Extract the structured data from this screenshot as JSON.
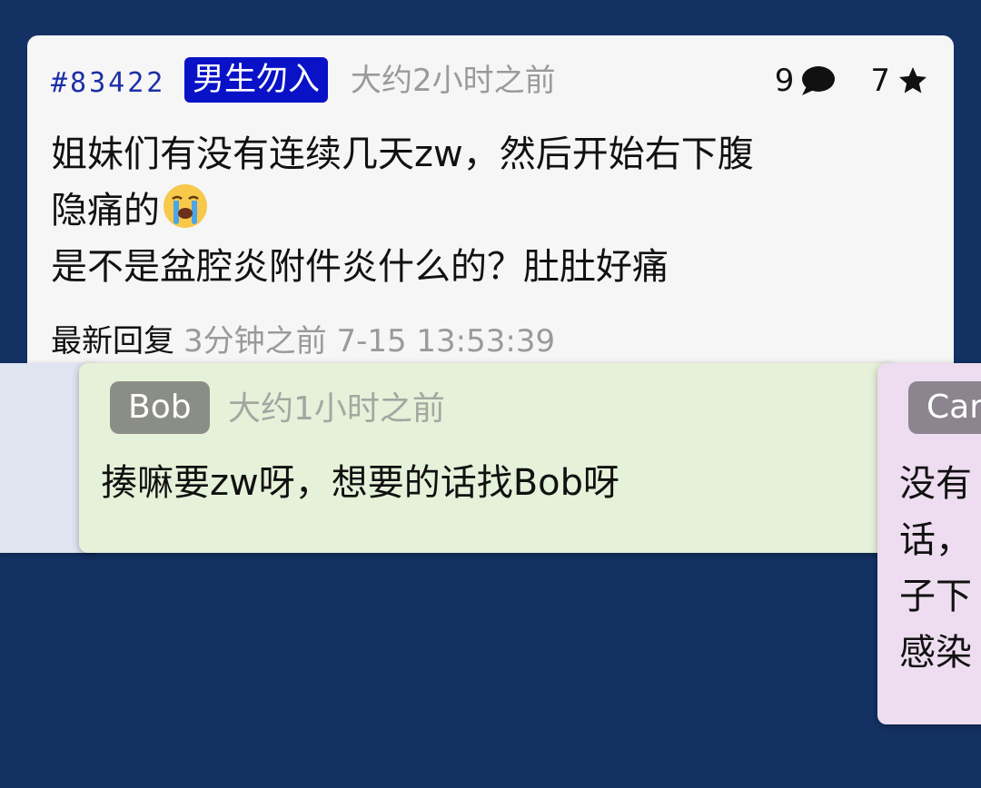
{
  "post": {
    "id": "#83422",
    "tag": "男生勿入",
    "time": "大约2小时之前",
    "comment_count": "9",
    "star_count": "7",
    "body_line1": "姐妹们有没有连续几天zw，然后开始右下腹",
    "body_line2": "隐痛的",
    "body_line3": "是不是盆腔炎附件炎什么的？肚肚好痛",
    "emoji": "loudly-crying-face",
    "latest_label": "最新回复",
    "latest_time": "3分钟之前 7-15 13:53:39"
  },
  "replies": [
    {
      "author": "Bob",
      "time": "大约1小时之前",
      "text": "揍嘛要zw呀，想要的话找Bob呀"
    },
    {
      "author": "Car",
      "lines": [
        "没有",
        "话，",
        "子下",
        "感染"
      ]
    }
  ],
  "colors": {
    "background": "#133163",
    "tag_bg": "#0a12c7",
    "post_id": "#1d2fa6",
    "bob_card": "#e6f1d9",
    "car_card": "#eeddf0"
  }
}
